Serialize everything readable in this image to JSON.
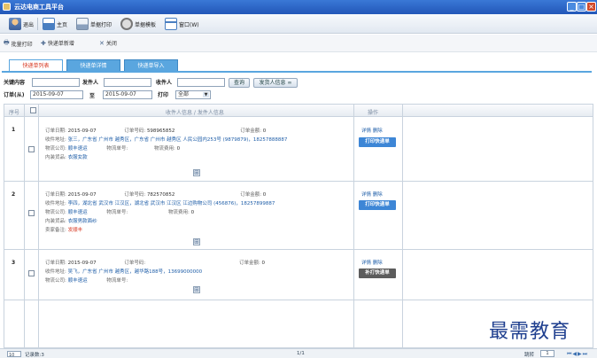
{
  "window": {
    "title": "云达电商工具平台",
    "min": "_",
    "max": "□",
    "close": "×"
  },
  "toolbar": {
    "items": [
      {
        "label": "退出"
      },
      {
        "label": "主页"
      },
      {
        "label": "单据打印"
      },
      {
        "label": "单据模板"
      },
      {
        "label": "窗口(W)"
      }
    ]
  },
  "actions": {
    "batch_print": "批量打印",
    "new_express": "快递单新增",
    "close": "关闭"
  },
  "tabs": [
    {
      "label": "快递单列表",
      "active": true
    },
    {
      "label": "快递单详情",
      "active": false
    },
    {
      "label": "快递单导入",
      "active": false
    }
  ],
  "filters": {
    "keyword_label": "关键内容",
    "sender_label": "发件人",
    "receiver_label": "收件人",
    "query_button": "查询",
    "sender_info_button": "发货人信息 ∞",
    "order_date_label": "订单(从)",
    "date_from": "2015-09-07",
    "to_label": "至",
    "date_to": "2015-09-07",
    "print_label": "打印",
    "print_value": "全部"
  },
  "grid": {
    "col_index": "序号",
    "col_info": "收件人信息 / 发件人信息",
    "col_ops": "操作"
  },
  "orders": [
    {
      "index": "1",
      "date_label": "订单日期:",
      "date": "2015-09-07",
      "no_label": "订单号码:",
      "no": "598965852",
      "amount_label": "订单金额:",
      "amount": "0",
      "addr_label": "收件地址:",
      "addr": "张三，广东省 广州市 越秀区，广东省 广州市 越秀区 人民公园内253号 (9879879)，18257888887",
      "company_label": "物流公司:",
      "company": "顺丰速运",
      "track_label": "物流单号:",
      "track": "",
      "fee_label": "物流费用:",
      "fee": "0",
      "goods_label": "内装货品:",
      "goods": "衣服女款",
      "remark_label": "",
      "remark": "",
      "detail": "详情",
      "delete": "删除",
      "print_btn": "打印快递单"
    },
    {
      "index": "2",
      "date_label": "订单日期:",
      "date": "2015-09-07",
      "no_label": "订单号码:",
      "no": "782570852",
      "amount_label": "订单金额:",
      "amount": "0",
      "addr_label": "收件地址:",
      "addr": "李四，湖北省 武汉市 江汉区，湖北省 武汉市 江汉区 江边购物公司 (456876)，18257899887",
      "company_label": "物流公司:",
      "company": "顺丰速运",
      "track_label": "物流单号:",
      "track": "",
      "fee_label": "物流费用:",
      "fee": "0",
      "goods_label": "内装货品:",
      "goods": "衣服男款面纱",
      "remark_label": "卖家备注:",
      "remark": "发顺丰",
      "detail": "详情",
      "delete": "删除",
      "print_btn": "打印快递单"
    },
    {
      "index": "3",
      "date_label": "订单日期:",
      "date": "2015-09-07",
      "no_label": "订单号码:",
      "no": "",
      "amount_label": "订单金额:",
      "amount": "0",
      "addr_label": "收件地址:",
      "addr": "吴飞，广东省 广州市 越秀区，越华路188号，13699000000",
      "company_label": "物流公司:",
      "company": "顺丰速运",
      "track_label": "物流单号:",
      "track": "",
      "fee_label": "",
      "fee": "",
      "goods_label": "",
      "goods": "",
      "remark_label": "",
      "remark": "",
      "detail": "详情",
      "delete": "删除",
      "print_btn": "补打快递单"
    }
  ],
  "expand_glyph": "⊞",
  "status": {
    "page_size": "10",
    "record_count": "记录数:3",
    "page_info": "1/1",
    "jump_label": "跳转",
    "jump_value": "1",
    "nav": "⏮◀▶⏭"
  },
  "watermark": "最需教育"
}
